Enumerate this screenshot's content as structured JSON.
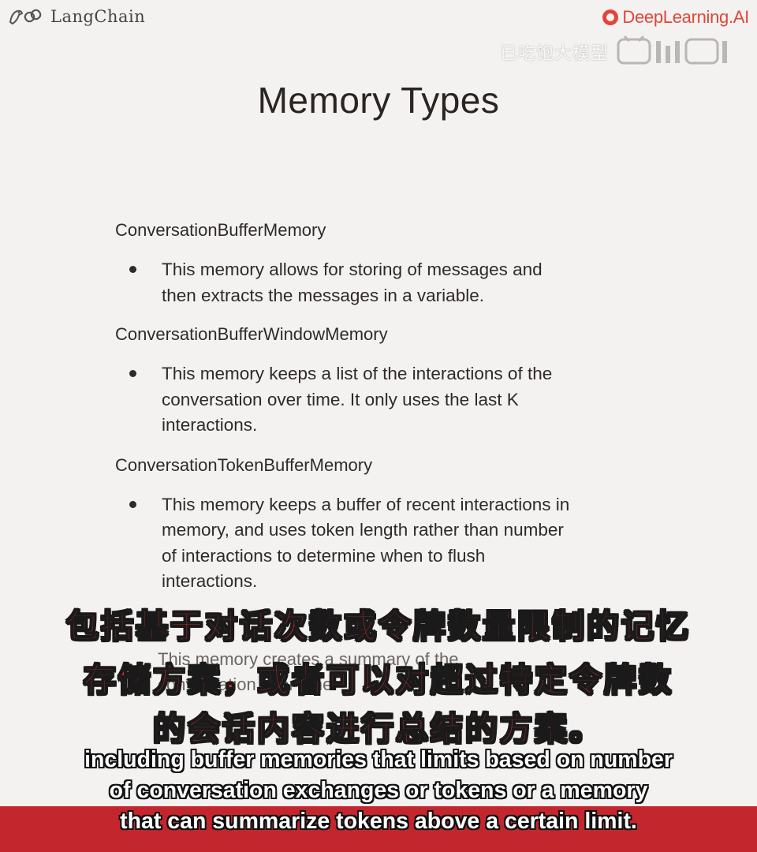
{
  "branding": {
    "left_logo_text": "LangChain",
    "right_logo_text": "DeepLearning.AI",
    "watermark_text": "已吃饱大模型",
    "colors": {
      "deeplearning_red": "#e0463a",
      "subtitle_band": "#c4262e",
      "subtitle_cn": "#d8312a"
    }
  },
  "slide": {
    "title": "Memory Types",
    "items": [
      {
        "name": "ConversationBufferMemory",
        "desc": [
          "This memory allows for storing of messages and",
          "then extracts the messages in a variable."
        ]
      },
      {
        "name": "ConversationBufferWindowMemory",
        "desc": [
          "This memory keeps a list of the interactions of the",
          "conversation over time. It only uses the last K",
          "interactions."
        ]
      },
      {
        "name": "ConversationTokenBufferMemory",
        "desc": [
          "This memory keeps a buffer of recent interactions in",
          "memory, and uses token length rather than number",
          "of interactions to determine when to flush",
          "interactions."
        ]
      }
    ],
    "partially_hidden": [
      "This memory creates a summary of the",
      "conversation over time."
    ]
  },
  "subtitles": {
    "cn": [
      "包括基于对话次数或令牌数量限制的记忆",
      "存储方案，或者可以对超过特定令牌数",
      "的会话内容进行总结的方案。"
    ],
    "en": [
      "including buffer memories that limits based on number",
      "of conversation exchanges or tokens or a memory",
      "that can summarize tokens above a certain limit."
    ]
  }
}
